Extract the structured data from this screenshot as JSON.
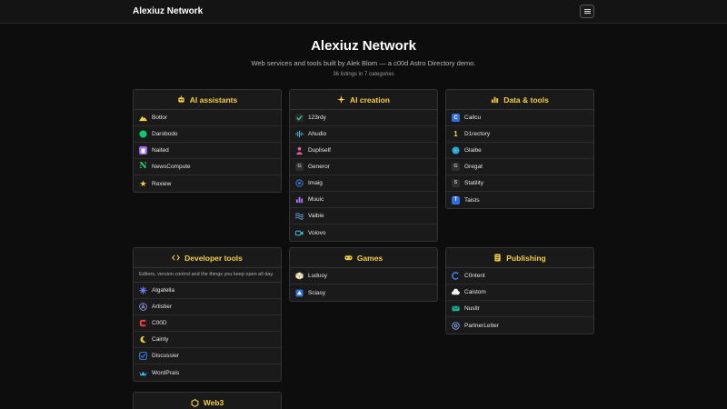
{
  "nav": {
    "brand": "Alexiuz Network",
    "menu_icon": "hamburger-menu-icon"
  },
  "hero": {
    "title": "Alexiuz Network",
    "subtitle": "Web services and tools built by Alek Blom — a c00d Astro Directory demo.",
    "count": "36 listings in 7 categories"
  },
  "colors": {
    "accent": "#f5cf40",
    "background": "#0d0d0d",
    "card": "#1a1a1a",
    "border": "#333333"
  },
  "categories": [
    {
      "title": "AI assistants",
      "icon": "robot-icon",
      "items": [
        {
          "label": "Botlor",
          "icon": "mountain-icon"
        },
        {
          "label": "Darobodo",
          "icon": "green-circle-icon"
        },
        {
          "label": "Naited",
          "icon": "purple-square-icon"
        },
        {
          "label": "NewsCompute",
          "icon": "n-letter-icon"
        },
        {
          "label": "Rexiew",
          "icon": "star-icon"
        }
      ]
    },
    {
      "title": "AI creation",
      "icon": "sparkle-icon",
      "items": [
        {
          "label": "123rdy",
          "icon": "checkmark-icon"
        },
        {
          "label": "Ahudio",
          "icon": "waveform-icon"
        },
        {
          "label": "Dupliself",
          "icon": "person-icon"
        },
        {
          "label": "Generor",
          "icon": "g-letter-icon"
        },
        {
          "label": "Imaig",
          "icon": "target-icon"
        },
        {
          "label": "Muuic",
          "icon": "bars-icon"
        },
        {
          "label": "Vaibie",
          "icon": "waves-icon"
        },
        {
          "label": "Voiovo",
          "icon": "video-camera-icon"
        }
      ]
    },
    {
      "title": "Data & tools",
      "icon": "bar-chart-icon",
      "items": [
        {
          "label": "Cailcu",
          "icon": "c-letter-icon"
        },
        {
          "label": "D1rectory",
          "icon": "number-one-icon"
        },
        {
          "label": "Glaibe",
          "icon": "globe-icon"
        },
        {
          "label": "Gregat",
          "icon": "g-letter-icon"
        },
        {
          "label": "Statility",
          "icon": "s-letter-icon"
        },
        {
          "label": "Taists",
          "icon": "t-letter-icon"
        }
      ]
    },
    {
      "title": "Developer tools",
      "icon": "code-icon",
      "description": "Editors, version control and the things you keep open all day.",
      "items": [
        {
          "label": "Algatella",
          "icon": "asterisk-icon"
        },
        {
          "label": "Artistier",
          "icon": "a-circle-icon"
        },
        {
          "label": "C00D",
          "icon": "c-red-icon"
        },
        {
          "label": "Cainty",
          "icon": "crescent-icon"
        },
        {
          "label": "Discussier",
          "icon": "check-square-icon"
        },
        {
          "label": "WordPrais",
          "icon": "crown-icon"
        }
      ]
    },
    {
      "title": "Games",
      "icon": "gamepad-icon",
      "items": [
        {
          "label": "Ludusy",
          "icon": "cube-icon"
        },
        {
          "label": "Sciasy",
          "icon": "gem-icon"
        }
      ]
    },
    {
      "title": "Publishing",
      "icon": "document-icon",
      "items": [
        {
          "label": "C0ntent",
          "icon": "c-ring-icon"
        },
        {
          "label": "Caistom",
          "icon": "cloud-icon"
        },
        {
          "label": "Nusltr",
          "icon": "envelope-icon"
        },
        {
          "label": "PartnerLetter",
          "icon": "at-sign-icon"
        }
      ]
    },
    {
      "title": "Web3",
      "icon": "hexagon-icon",
      "items": []
    }
  ]
}
